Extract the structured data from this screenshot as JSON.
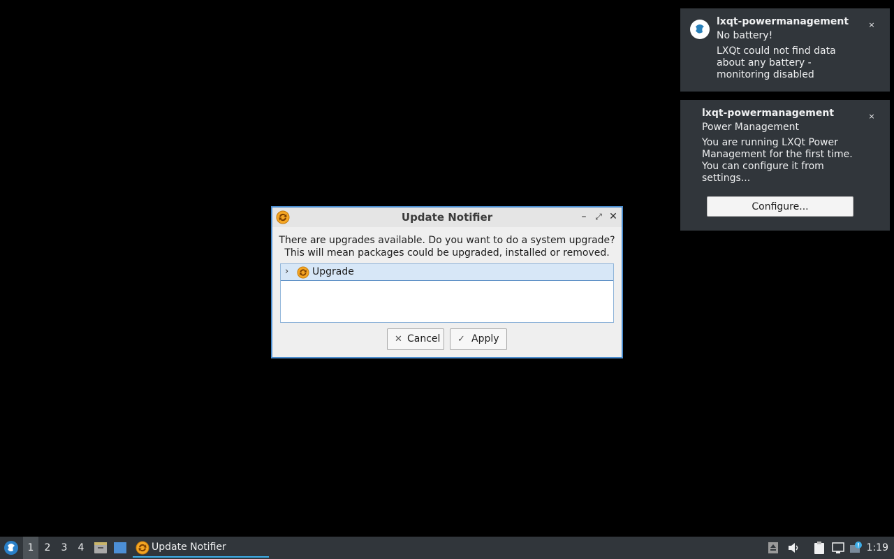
{
  "notifications": [
    {
      "app": "lxqt-powermanagement",
      "summary": "No battery!",
      "body": "LXQt could not find data about any battery - monitoring disabled",
      "close": "×"
    },
    {
      "app": "lxqt-powermanagement",
      "summary": "Power Management",
      "body": "You are running LXQt Power Management for the first time. You can configure it from settings...",
      "close": "×",
      "action": "Configure..."
    }
  ],
  "dialog": {
    "title": "Update Notifier",
    "minimize": "–",
    "maximize": "⤢",
    "close": "✕",
    "message_line1": "There are upgrades available. Do you want to do a system upgrade?",
    "message_line2": "This will mean packages could be upgraded, installed or removed.",
    "tree_items": [
      {
        "label": "Upgrade",
        "expander": "›"
      }
    ],
    "cancel_label": "Cancel",
    "cancel_icon": "✕",
    "apply_label": "Apply",
    "apply_icon": "✓"
  },
  "taskbar": {
    "desktops": [
      "1",
      "2",
      "3",
      "4"
    ],
    "active_desktop": "1",
    "task_label": "Update Notifier",
    "clock": "1:19"
  },
  "colors": {
    "accent": "#3daee9",
    "panel": "#31363b",
    "dialog_border": "#4b8dcf",
    "update_icon": "#f5a623"
  }
}
